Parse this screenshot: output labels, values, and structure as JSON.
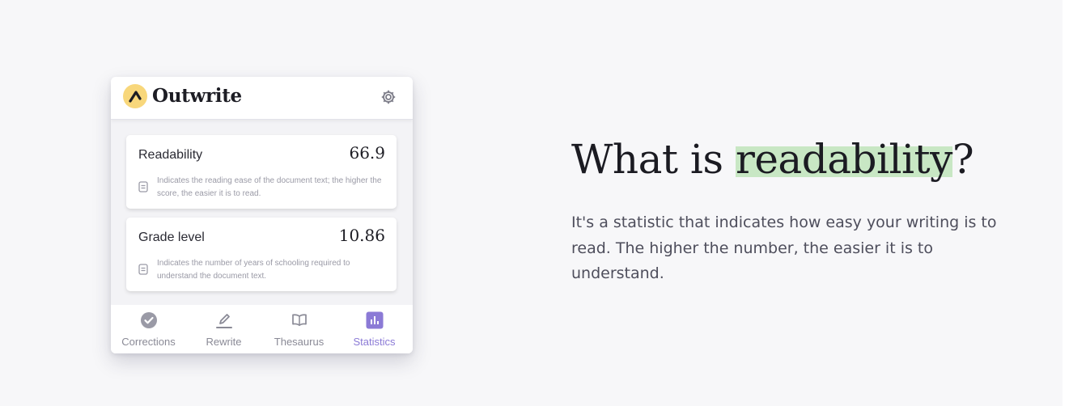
{
  "widget": {
    "brand": "Outwrite",
    "metrics": [
      {
        "label": "Readability",
        "value": "66.9",
        "description": "Indicates the reading ease of the document text; the higher the score, the easier it is to read."
      },
      {
        "label": "Grade level",
        "value": "10.86",
        "description": "Indicates the number of years of schooling required to understand the document text."
      }
    ],
    "nav": [
      {
        "label": "Corrections",
        "icon": "check-circle-icon"
      },
      {
        "label": "Rewrite",
        "icon": "pencil-icon"
      },
      {
        "label": "Thesaurus",
        "icon": "book-icon"
      },
      {
        "label": "Statistics",
        "icon": "bar-chart-icon",
        "active": true
      }
    ],
    "colors": {
      "accent": "#8b7ad6",
      "logo": "#f8d77b"
    }
  },
  "hero": {
    "headline_pre": "What is ",
    "headline_highlight": "readability",
    "headline_post": "?",
    "body": "It's a statistic that indicates how easy your writing is to read. The higher the number, the easier it is to understand.",
    "highlight_color": "#c8e7c4"
  }
}
